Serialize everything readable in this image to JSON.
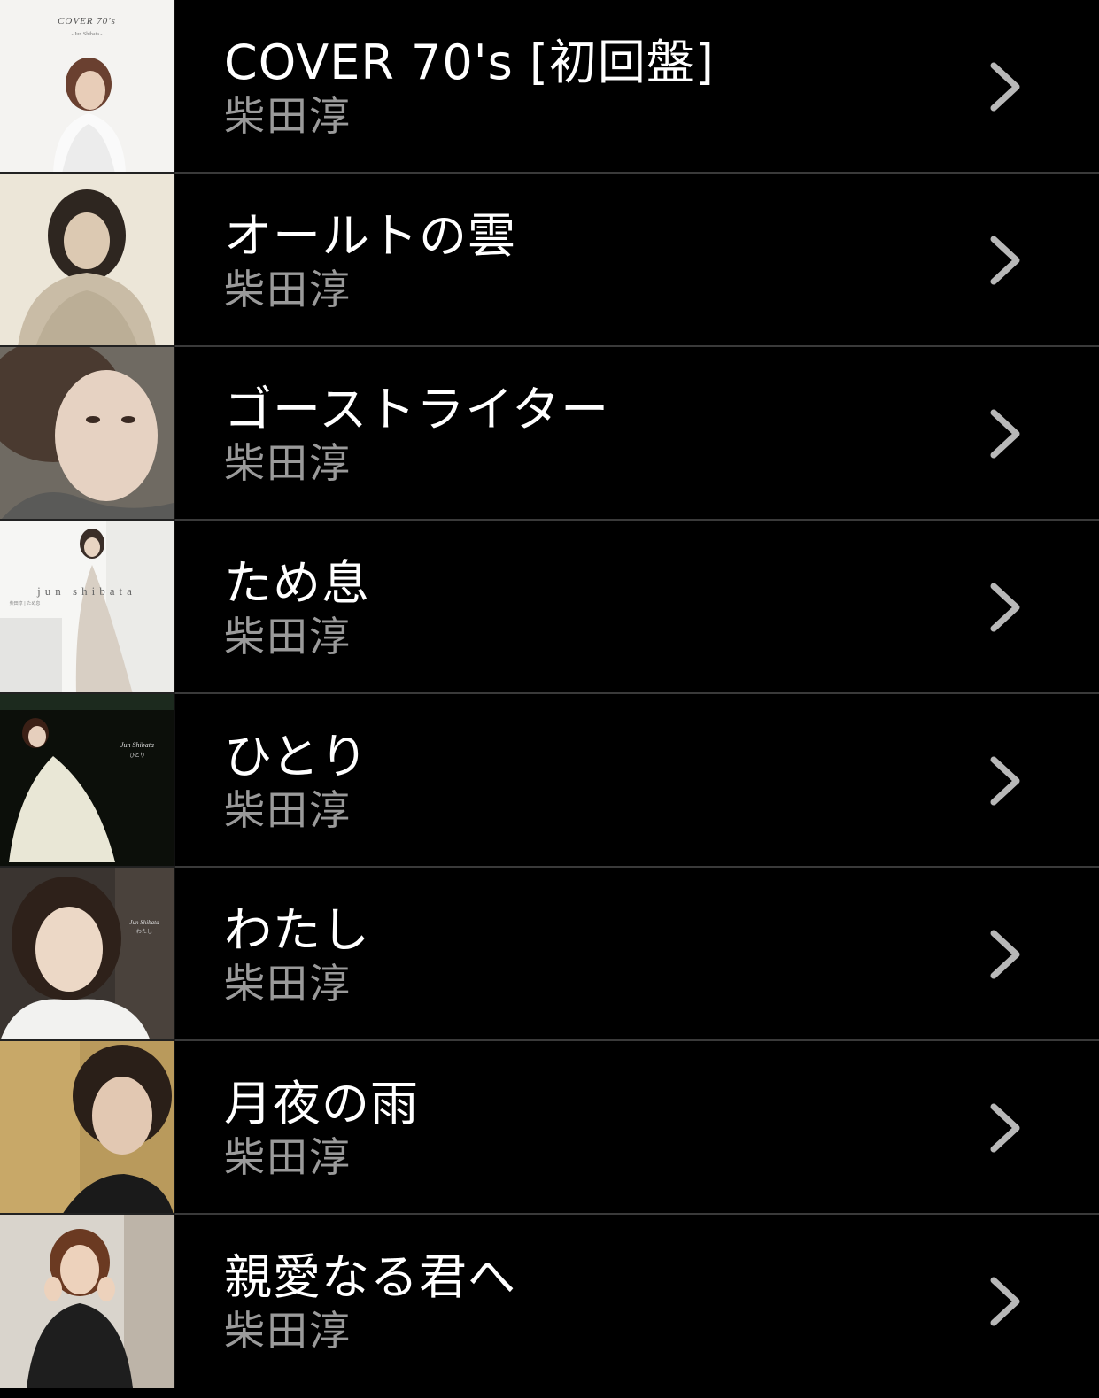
{
  "list": {
    "chevron_color": "#b8b8b8",
    "title_color": "#ffffff",
    "artist_color": "#9a9a9a",
    "background": "#000000",
    "items": [
      {
        "title": "COVER 70's [初回盤]",
        "artist": "柴田淳",
        "art": {
          "name": "album-art-cover-70s",
          "cover_title": "COVER 70's",
          "cover_subtitle": "- Jun Shibata -"
        }
      },
      {
        "title": "オールトの雲",
        "artist": "柴田淳",
        "art": {
          "name": "album-art-oort-cloud"
        }
      },
      {
        "title": "ゴーストライター",
        "artist": "柴田淳",
        "art": {
          "name": "album-art-ghostwriter"
        }
      },
      {
        "title": "ため息",
        "artist": "柴田淳",
        "art": {
          "name": "album-art-tameiki",
          "cover_title": "jun shibata",
          "cover_subtitle": "柴田淳 | ため息"
        }
      },
      {
        "title": "ひとり",
        "artist": "柴田淳",
        "art": {
          "name": "album-art-hitori",
          "cover_title": "Jun Shibata",
          "cover_subtitle": "ひとり"
        }
      },
      {
        "title": "わたし",
        "artist": "柴田淳",
        "art": {
          "name": "album-art-watashi",
          "cover_title": "Jun Shibata",
          "cover_subtitle": "わたし"
        }
      },
      {
        "title": "月夜の雨",
        "artist": "柴田淳",
        "art": {
          "name": "album-art-tsukiyo-no-ame"
        }
      },
      {
        "title": "親愛なる君へ",
        "artist": "柴田淳",
        "art": {
          "name": "album-art-shinai-naru-kimi-e"
        }
      }
    ]
  }
}
